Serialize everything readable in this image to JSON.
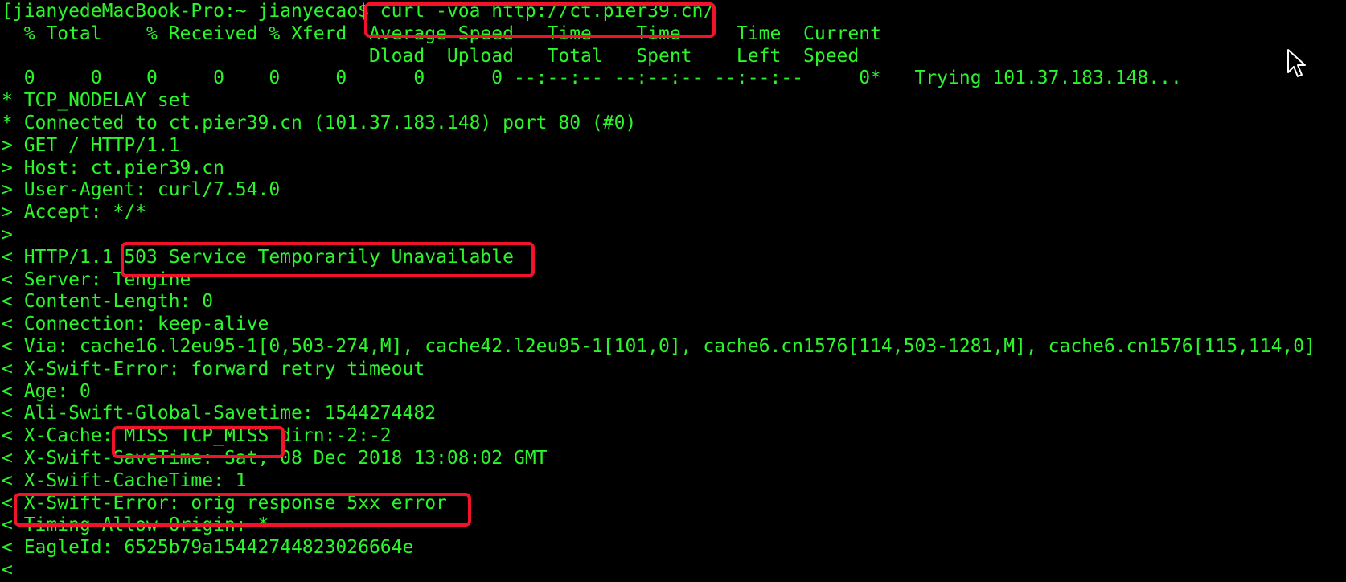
{
  "terminal": {
    "lines": [
      "[jianyedeMacBook-Pro:~ jianyecao$ curl -voa http://ct.pier39.cn/",
      "  % Total    % Received % Xferd  Average Speed   Time    Time     Time  Current",
      "                                 Dload  Upload   Total   Spent    Left  Speed",
      "  0     0    0     0    0     0      0      0 --:--:-- --:--:-- --:--:--     0*   Trying 101.37.183.148...",
      "* TCP_NODELAY set",
      "* Connected to ct.pier39.cn (101.37.183.148) port 80 (#0)",
      "> GET / HTTP/1.1",
      "> Host: ct.pier39.cn",
      "> User-Agent: curl/7.54.0",
      "> Accept: */*",
      ">",
      "< HTTP/1.1 503 Service Temporarily Unavailable",
      "< Server: Tengine",
      "< Content-Length: 0",
      "< Connection: keep-alive",
      "< Via: cache16.l2eu95-1[0,503-274,M], cache42.l2eu95-1[101,0], cache6.cn1576[114,503-1281,M], cache6.cn1576[115,114,0]",
      "< X-Swift-Error: forward retry timeout",
      "< Age: 0",
      "< Ali-Swift-Global-Savetime: 1544274482",
      "< X-Cache: MISS TCP_MISS dirn:-2:-2",
      "< X-Swift-SaveTime: Sat, 08 Dec 2018 13:08:02 GMT",
      "< X-Swift-CacheTime: 1",
      "< X-Swift-Error: orig response 5xx error",
      "< Timing-Allow-Origin: *",
      "< EagleId: 6525b79a15442744823026664e",
      "<"
    ]
  },
  "colors": {
    "text": "#2bf52b",
    "background": "#000000",
    "highlight_box": "#f2132b"
  },
  "cursor_icon": "mouse-pointer-arrow"
}
